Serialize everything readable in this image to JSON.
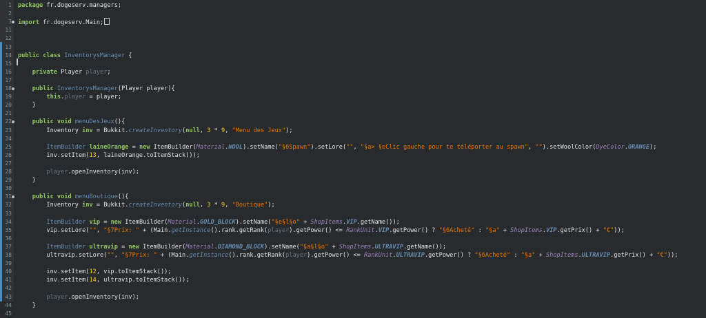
{
  "editor": {
    "lines": [
      {
        "n": "1",
        "fold": false,
        "code": [
          [
            "kw",
            "package"
          ],
          [
            "var",
            " fr.dogeserv.managers;"
          ]
        ]
      },
      {
        "n": "2",
        "fold": false,
        "code": []
      },
      {
        "n": "3",
        "fold": true,
        "code": [
          [
            "kw",
            "import"
          ],
          [
            "var",
            " fr.dogeserv.Main;"
          ]
        ],
        "box": true
      },
      {
        "n": "11",
        "fold": false,
        "code": []
      },
      {
        "n": "12",
        "fold": false,
        "code": []
      },
      {
        "n": "13",
        "fold": false,
        "code": []
      },
      {
        "n": "14",
        "fold": false,
        "code": [
          [
            "kw",
            "public class"
          ],
          [
            "var",
            " "
          ],
          [
            "cls",
            "InventorysManager"
          ],
          [
            "var",
            " {"
          ]
        ]
      },
      {
        "n": "15",
        "fold": false,
        "code": []
      },
      {
        "n": "16",
        "fold": false,
        "code": [
          [
            "var",
            "    "
          ],
          [
            "kw",
            "private"
          ],
          [
            "var",
            " Player "
          ],
          [
            "fld",
            "player"
          ],
          [
            "var",
            ";"
          ]
        ]
      },
      {
        "n": "17",
        "fold": false,
        "code": []
      },
      {
        "n": "18",
        "fold": true,
        "code": [
          [
            "var",
            "    "
          ],
          [
            "kw",
            "public"
          ],
          [
            "var",
            " "
          ],
          [
            "cls",
            "InventorysManager"
          ],
          [
            "var",
            "(Player player){"
          ]
        ]
      },
      {
        "n": "19",
        "fold": false,
        "code": [
          [
            "var",
            "        "
          ],
          [
            "kw",
            "this"
          ],
          [
            "var",
            "."
          ],
          [
            "fld",
            "player"
          ],
          [
            "var",
            " = player;"
          ]
        ]
      },
      {
        "n": "20",
        "fold": false,
        "code": [
          [
            "var",
            "    }"
          ]
        ]
      },
      {
        "n": "21",
        "fold": false,
        "code": []
      },
      {
        "n": "22",
        "fold": true,
        "code": [
          [
            "var",
            "    "
          ],
          [
            "kw",
            "public void"
          ],
          [
            "var",
            " "
          ],
          [
            "mth",
            "menuDesJeux"
          ],
          [
            "var",
            "(){"
          ]
        ]
      },
      {
        "n": "23",
        "fold": false,
        "code": [
          [
            "var",
            "        Inventory "
          ],
          [
            "kw",
            "inv"
          ],
          [
            "var",
            " = Bukkit."
          ],
          [
            "mth it",
            "createInventory"
          ],
          [
            "var",
            "("
          ],
          [
            "kw",
            "null"
          ],
          [
            "var",
            ", "
          ],
          [
            "num",
            "3"
          ],
          [
            "var",
            " * "
          ],
          [
            "num",
            "9"
          ],
          [
            "var",
            ", "
          ],
          [
            "str",
            "\"Menu des Jeux\""
          ],
          [
            "var",
            ");"
          ]
        ]
      },
      {
        "n": "24",
        "fold": false,
        "code": []
      },
      {
        "n": "25",
        "fold": false,
        "code": [
          [
            "var",
            "        "
          ],
          [
            "cls",
            "ItemBuilder"
          ],
          [
            "var",
            " "
          ],
          [
            "kw",
            "laineOrange"
          ],
          [
            "var",
            " = "
          ],
          [
            "kw",
            "new"
          ],
          [
            "var",
            " ItemBuilder("
          ],
          [
            "dcls",
            "Material"
          ],
          [
            "var",
            "."
          ],
          [
            "sfld",
            "WOOL"
          ],
          [
            "var",
            ").setName("
          ],
          [
            "str",
            "\"§6Spawn\""
          ],
          [
            "var",
            ").setLore("
          ],
          [
            "str",
            "\"\""
          ],
          [
            "var",
            ", "
          ],
          [
            "str",
            "\"§a> §eClic gauche pour te téléporter au spawn\""
          ],
          [
            "var",
            ", "
          ],
          [
            "str",
            "\"\""
          ],
          [
            "var",
            ").setWoolColor("
          ],
          [
            "dcls",
            "DyeColor"
          ],
          [
            "var",
            "."
          ],
          [
            "sfld",
            "ORANGE"
          ],
          [
            "var",
            ");"
          ]
        ]
      },
      {
        "n": "26",
        "fold": false,
        "code": [
          [
            "var",
            "        inv.setItem("
          ],
          [
            "num",
            "13"
          ],
          [
            "var",
            ", laineOrange.toItemStack());"
          ]
        ]
      },
      {
        "n": "27",
        "fold": false,
        "code": []
      },
      {
        "n": "28",
        "fold": false,
        "code": [
          [
            "var",
            "        "
          ],
          [
            "fld",
            "player"
          ],
          [
            "var",
            ".openInventory(inv);"
          ]
        ]
      },
      {
        "n": "29",
        "fold": false,
        "code": [
          [
            "var",
            "    }"
          ]
        ]
      },
      {
        "n": "30",
        "fold": false,
        "code": []
      },
      {
        "n": "31",
        "fold": true,
        "code": [
          [
            "var",
            "    "
          ],
          [
            "kw",
            "public void"
          ],
          [
            "var",
            " "
          ],
          [
            "mth",
            "menuBoutique"
          ],
          [
            "var",
            "(){"
          ]
        ]
      },
      {
        "n": "32",
        "fold": false,
        "code": [
          [
            "var",
            "        Inventory "
          ],
          [
            "kw",
            "inv"
          ],
          [
            "var",
            " = Bukkit."
          ],
          [
            "mth it",
            "createInventory"
          ],
          [
            "var",
            "("
          ],
          [
            "kw",
            "null"
          ],
          [
            "var",
            ", "
          ],
          [
            "num",
            "3"
          ],
          [
            "var",
            " * "
          ],
          [
            "num",
            "9"
          ],
          [
            "var",
            ", "
          ],
          [
            "str",
            "\"Boutique\""
          ],
          [
            "var",
            ");"
          ]
        ]
      },
      {
        "n": "33",
        "fold": false,
        "code": []
      },
      {
        "n": "34",
        "fold": false,
        "code": [
          [
            "var",
            "        "
          ],
          [
            "cls",
            "ItemBuilder"
          ],
          [
            "var",
            " "
          ],
          [
            "kw",
            "vip"
          ],
          [
            "var",
            " = "
          ],
          [
            "kw",
            "new"
          ],
          [
            "var",
            " ItemBuilder("
          ],
          [
            "dcls",
            "Material"
          ],
          [
            "var",
            "."
          ],
          [
            "sfld",
            "GOLD_BLOCK"
          ],
          [
            "var",
            ").setName("
          ],
          [
            "str",
            "\"§e§l§o\""
          ],
          [
            "var",
            " + "
          ],
          [
            "dcls",
            "ShopItems"
          ],
          [
            "var",
            "."
          ],
          [
            "sfld",
            "VIP"
          ],
          [
            "var",
            ".getName());"
          ]
        ]
      },
      {
        "n": "35",
        "fold": false,
        "code": [
          [
            "var",
            "        vip.setLore("
          ],
          [
            "str",
            "\"\""
          ],
          [
            "var",
            ", "
          ],
          [
            "str",
            "\"§7Prix: \""
          ],
          [
            "var",
            " + (Main."
          ],
          [
            "mth it",
            "getInstance"
          ],
          [
            "var",
            "().rank.getRank("
          ],
          [
            "fld",
            "player"
          ],
          [
            "var",
            ").getPower() <= "
          ],
          [
            "dcls",
            "RankUnit"
          ],
          [
            "var",
            "."
          ],
          [
            "sfld",
            "VIP"
          ],
          [
            "var",
            ".getPower() ? "
          ],
          [
            "str",
            "\"§6Acheté\""
          ],
          [
            "var",
            " : "
          ],
          [
            "str",
            "\"§a\""
          ],
          [
            "var",
            " + "
          ],
          [
            "dcls",
            "ShopItems"
          ],
          [
            "var",
            "."
          ],
          [
            "sfld",
            "VIP"
          ],
          [
            "var",
            ".getPrix() + "
          ],
          [
            "str",
            "\"€\""
          ],
          [
            "var",
            "));"
          ]
        ]
      },
      {
        "n": "36",
        "fold": false,
        "code": []
      },
      {
        "n": "37",
        "fold": false,
        "code": [
          [
            "var",
            "        "
          ],
          [
            "cls",
            "ItemBuilder"
          ],
          [
            "var",
            " "
          ],
          [
            "kw",
            "ultravip"
          ],
          [
            "var",
            " = "
          ],
          [
            "kw",
            "new"
          ],
          [
            "var",
            " ItemBuilder("
          ],
          [
            "dcls",
            "Material"
          ],
          [
            "var",
            "."
          ],
          [
            "sfld",
            "DIAMOND_BLOCK"
          ],
          [
            "var",
            ").setName("
          ],
          [
            "str",
            "\"§a§l§o\""
          ],
          [
            "var",
            " + "
          ],
          [
            "dcls",
            "ShopItems"
          ],
          [
            "var",
            "."
          ],
          [
            "sfld",
            "ULTRAVIP"
          ],
          [
            "var",
            ".getName());"
          ]
        ]
      },
      {
        "n": "38",
        "fold": false,
        "code": [
          [
            "var",
            "        ultravip.setLore("
          ],
          [
            "str",
            "\"\""
          ],
          [
            "var",
            ", "
          ],
          [
            "str",
            "\"§7Prix: \""
          ],
          [
            "var",
            " + (Main."
          ],
          [
            "mth it",
            "getInstance"
          ],
          [
            "var",
            "().rank.getRank("
          ],
          [
            "fld",
            "player"
          ],
          [
            "var",
            ").getPower() <= "
          ],
          [
            "dcls",
            "RankUnit"
          ],
          [
            "var",
            "."
          ],
          [
            "sfld",
            "ULTRAVIP"
          ],
          [
            "var",
            ".getPower() ? "
          ],
          [
            "str",
            "\"§6Acheté\""
          ],
          [
            "var",
            " : "
          ],
          [
            "str",
            "\"§a\""
          ],
          [
            "var",
            " + "
          ],
          [
            "dcls",
            "ShopItems"
          ],
          [
            "var",
            "."
          ],
          [
            "sfld",
            "ULTRAVIP"
          ],
          [
            "var",
            ".getPrix() + "
          ],
          [
            "str",
            "\"€\""
          ],
          [
            "var",
            "));"
          ]
        ]
      },
      {
        "n": "39",
        "fold": false,
        "code": []
      },
      {
        "n": "40",
        "fold": false,
        "code": [
          [
            "var",
            "        inv.setItem("
          ],
          [
            "num",
            "12"
          ],
          [
            "var",
            ", vip.toItemStack());"
          ]
        ]
      },
      {
        "n": "41",
        "fold": false,
        "code": [
          [
            "var",
            "        inv.setItem("
          ],
          [
            "num",
            "14"
          ],
          [
            "var",
            ", ultravip.toItemStack());"
          ]
        ]
      },
      {
        "n": "42",
        "fold": false,
        "code": []
      },
      {
        "n": "43",
        "fold": false,
        "code": [
          [
            "var",
            "        "
          ],
          [
            "fld",
            "player"
          ],
          [
            "var",
            ".openInventory(inv);"
          ]
        ]
      },
      {
        "n": "44",
        "fold": false,
        "code": [
          [
            "var",
            "    }"
          ]
        ]
      },
      {
        "n": "45",
        "fold": false,
        "code": []
      }
    ]
  }
}
